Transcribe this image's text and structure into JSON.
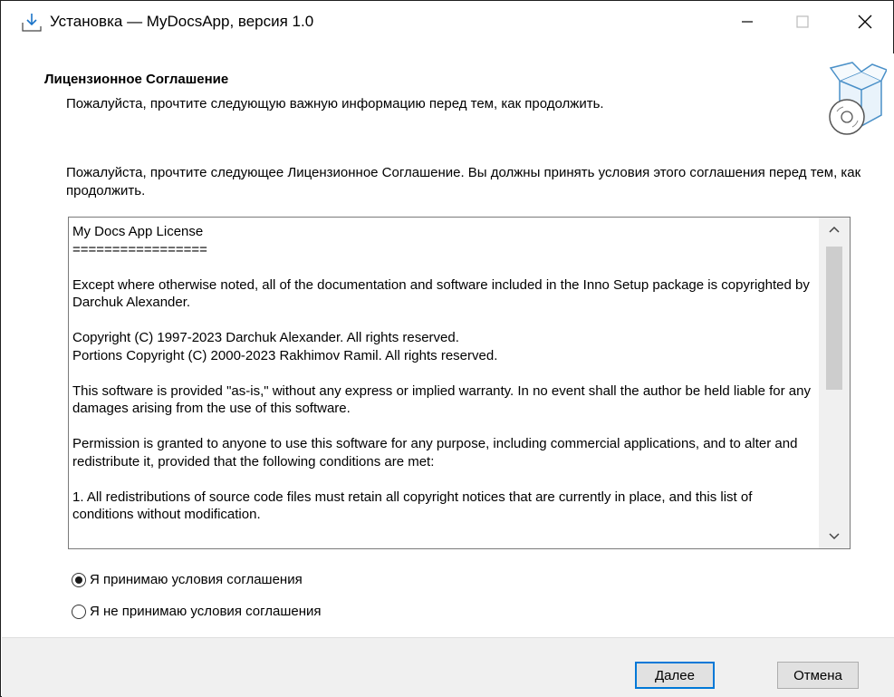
{
  "window": {
    "title": "Установка — MyDocsApp, версия 1.0"
  },
  "header": {
    "title": "Лицензионное Соглашение",
    "subtitle": "Пожалуйста, прочтите следующую важную информацию перед тем, как продолжить.",
    "icon": "box-disc-icon"
  },
  "content": {
    "intro": "Пожалуйста, прочтите следующее Лицензионное Соглашение. Вы должны принять условия этого соглашения перед тем, как продолжить.",
    "license_text": "My Docs App License\n=================\n\nExcept where otherwise noted, all of the documentation and software included in the Inno Setup package is copyrighted by Darchuk Alexander.\n\nCopyright (C) 1997-2023 Darchuk Alexander. All rights reserved.\nPortions Copyright (C) 2000-2023 Rakhimov Ramil. All rights reserved.\n\nThis software is provided \"as-is,\" without any express or implied warranty. In no event shall the author be held liable for any damages arising from the use of this software.\n\nPermission is granted to anyone to use this software for any purpose, including commercial applications, and to alter and redistribute it, provided that the following conditions are met:\n\n1. All redistributions of source code files must retain all copyright notices that are currently in place, and this list of conditions without modification."
  },
  "options": {
    "accept": "Я принимаю условия соглашения",
    "decline": "Я не принимаю условия соглашения",
    "selected": "accept"
  },
  "buttons": {
    "next": "Далее",
    "cancel": "Отмена"
  },
  "colors": {
    "accent": "#0078d7",
    "footer_bg": "#f0f0f0"
  }
}
